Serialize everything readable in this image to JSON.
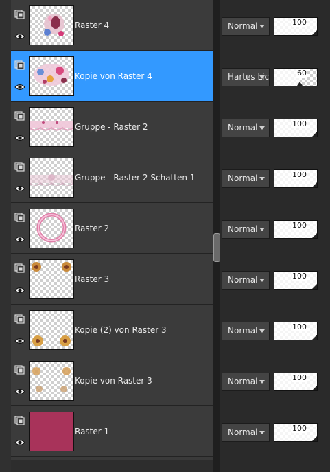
{
  "layers": [
    {
      "name": "Raster 4",
      "selected": false,
      "thumb": "figure",
      "blend": "Normal",
      "opacity": "100"
    },
    {
      "name": "Kopie von Raster 4",
      "selected": true,
      "thumb": "collage",
      "blend": "Hartes Licht",
      "opacity": "60"
    },
    {
      "name": "Gruppe - Raster 2",
      "selected": false,
      "thumb": "lace",
      "blend": "Normal",
      "opacity": "100"
    },
    {
      "name": "Gruppe - Raster 2 Schatten 1",
      "selected": false,
      "thumb": "lace-shadow",
      "blend": "Normal",
      "opacity": "100"
    },
    {
      "name": "Raster 2",
      "selected": false,
      "thumb": "ring",
      "blend": "Normal",
      "opacity": "100"
    },
    {
      "name": "Raster 3",
      "selected": false,
      "thumb": "flowers-top",
      "blend": "Normal",
      "opacity": "100"
    },
    {
      "name": "Kopie (2) von Raster 3",
      "selected": false,
      "thumb": "flowers-bottom",
      "blend": "Normal",
      "opacity": "100"
    },
    {
      "name": "Kopie von Raster 3",
      "selected": false,
      "thumb": "flowers-mid",
      "blend": "Normal",
      "opacity": "100"
    },
    {
      "name": "Raster 1",
      "selected": false,
      "thumb": "solid",
      "blend": "Normal",
      "opacity": "100"
    }
  ],
  "colors": {
    "selection": "#3399ff",
    "raster1_fill": "#a8335a"
  },
  "icons": {
    "visibility_toggle": "layer-mask-icon",
    "eye": "eye-icon",
    "splitter": "splitter-handle-icon"
  }
}
